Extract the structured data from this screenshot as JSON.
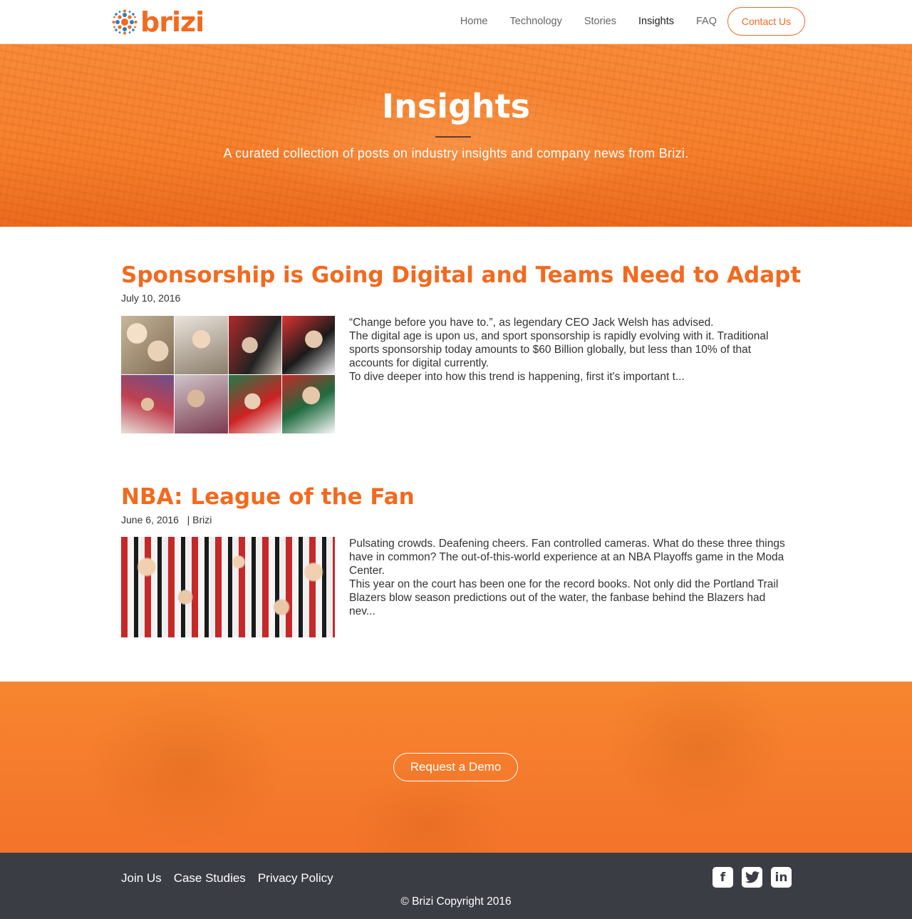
{
  "nav": {
    "logo_text": "brizi",
    "links": [
      {
        "label": "Home",
        "active": false
      },
      {
        "label": "Technology",
        "active": false
      },
      {
        "label": "Stories",
        "active": false
      },
      {
        "label": "Insights",
        "active": true
      },
      {
        "label": "FAQ",
        "active": false
      }
    ],
    "contact_label": "Contact Us"
  },
  "hero": {
    "title": "Insights",
    "subtitle": "A curated collection of posts on industry insights and company news from Brizi."
  },
  "posts": [
    {
      "title": "Sponsorship is Going Digital and Teams Need to Adapt",
      "date": "July 10, 2016",
      "excerpt": [
        "“Change before you have to.”, as legendary CEO Jack Welsh has advised.",
        "The digital age is upon us, and sport sponsorship is rapidly evolving with it. Traditional sports sponsorship today amounts to $60 Billion globally, but less than 10% of that accounts for digital currently.",
        "To dive deeper into how this trend is happening, first it's important t..."
      ]
    },
    {
      "title": "NBA: League of the Fan",
      "date": "June 6, 2016",
      "author": "| Brizi",
      "excerpt": [
        "Pulsating crowds. Deafening cheers. Fan controlled cameras. What do these three things have in common? The out-of-this-world experience at an NBA Playoffs game in the Moda Center.",
        "This year on the court has been one for the record books. Not only did the Portland Trail Blazers blow season predictions out of the water, the fanbase behind the Blazers had nev..."
      ]
    }
  ],
  "cta": {
    "demo_label": "Request a Demo"
  },
  "footer": {
    "links": [
      "Join Us",
      "Case Studies",
      "Privacy Policy"
    ],
    "social": [
      {
        "icon": "facebook-icon",
        "glyph": "f"
      },
      {
        "icon": "twitter-icon",
        "glyph": "t"
      },
      {
        "icon": "linkedin-icon",
        "glyph": "in"
      }
    ],
    "copyright": "© Brizi Copyright 2016"
  },
  "colors": {
    "accent": "#f26a1f",
    "footer_bg": "#3b3d45"
  }
}
